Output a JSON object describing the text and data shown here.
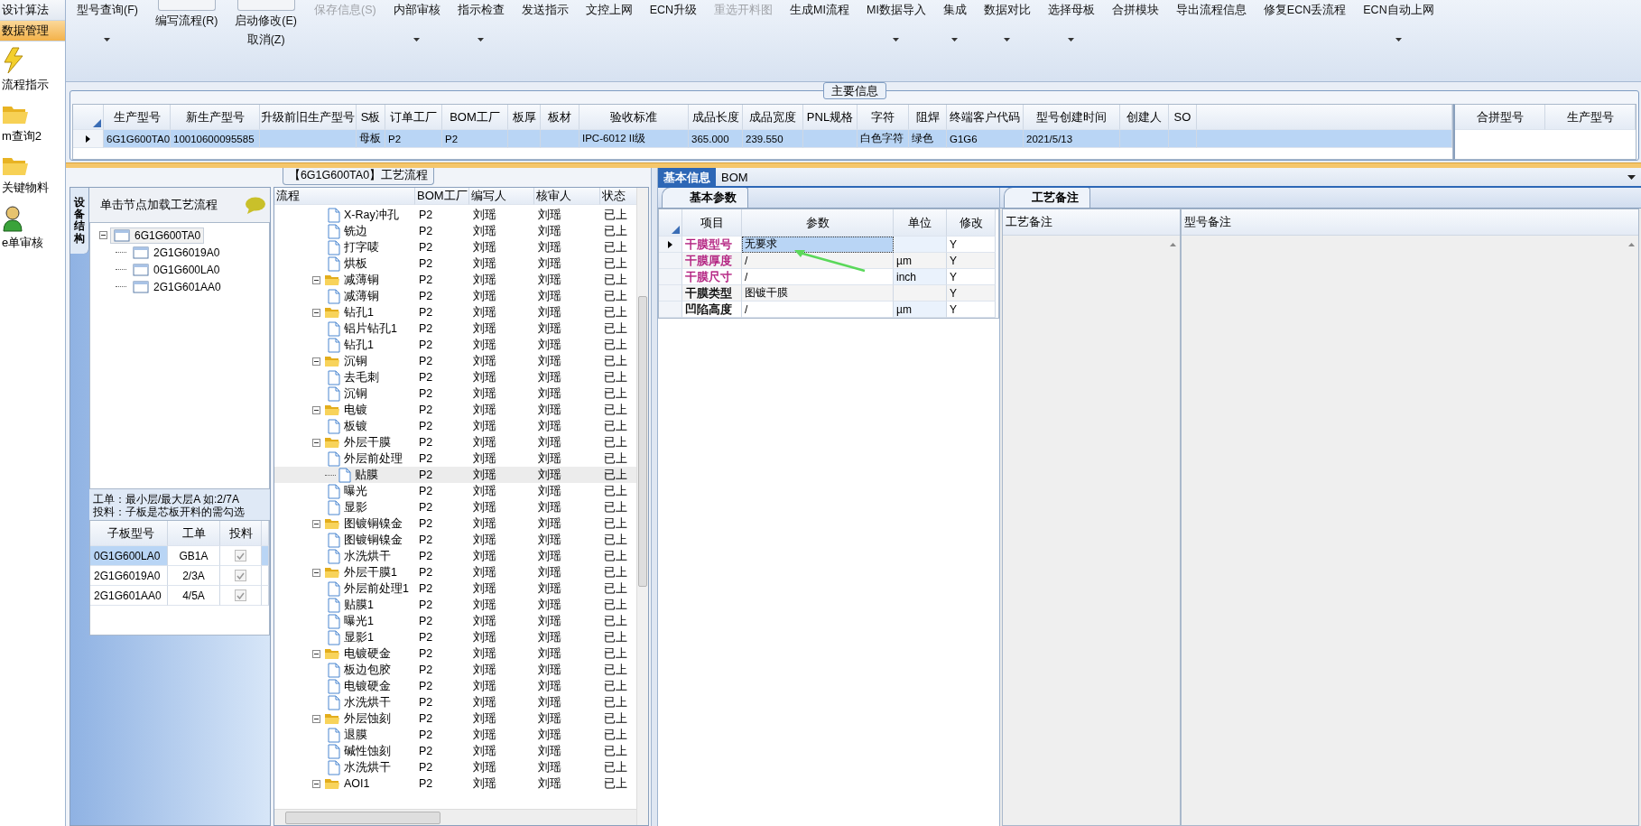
{
  "sidebar": {
    "items": [
      {
        "label": "设计算法",
        "kind": "text",
        "selected": false
      },
      {
        "label": "数据管理",
        "kind": "text",
        "selected": true
      },
      {
        "label": "流程指示",
        "kind": "lightning",
        "selected": false
      },
      {
        "label": "m查询2",
        "kind": "folder",
        "selected": false
      },
      {
        "label": "关键物料",
        "kind": "folder",
        "selected": false
      },
      {
        "label": "e单审核",
        "kind": "person",
        "selected": false
      }
    ]
  },
  "toolbar": {
    "buttons": [
      {
        "label": "型号查询(F)",
        "kind": "plain",
        "dropdown": true,
        "disabled": false
      },
      {
        "label": "编写流程(R)",
        "kind": "toggle",
        "on": false,
        "disabled": false
      },
      {
        "label": "启动修改(E)",
        "kind": "toggle",
        "below": "取消(Z)",
        "on": false,
        "disabled": false
      },
      {
        "label": "保存信息(S)",
        "kind": "plain",
        "dropdown": false,
        "disabled": true
      },
      {
        "label": "内部审核",
        "kind": "plain",
        "dropdown": true,
        "disabled": false
      },
      {
        "label": "指示检查",
        "kind": "plain",
        "dropdown": true,
        "disabled": false
      },
      {
        "label": "发送指示",
        "kind": "plain",
        "dropdown": false,
        "disabled": false
      },
      {
        "label": "文控上网",
        "kind": "plain",
        "dropdown": false,
        "disabled": false
      },
      {
        "label": "ECN升级",
        "kind": "plain",
        "dropdown": false,
        "disabled": false
      },
      {
        "label": "重选开料图",
        "kind": "plain",
        "dropdown": false,
        "disabled": true
      },
      {
        "label": "生成MI流程",
        "kind": "plain",
        "dropdown": false,
        "disabled": false
      },
      {
        "label": "MI数据导入",
        "kind": "plain",
        "dropdown": true,
        "disabled": false
      },
      {
        "label": "集成",
        "kind": "plain",
        "dropdown": true,
        "disabled": false
      },
      {
        "label": "数据对比",
        "kind": "plain",
        "dropdown": true,
        "disabled": false
      },
      {
        "label": "选择母板",
        "kind": "plain",
        "dropdown": true,
        "disabled": false
      },
      {
        "label": "合拼模块",
        "kind": "plain",
        "dropdown": false,
        "disabled": false
      },
      {
        "label": "导出流程信息",
        "kind": "plain",
        "dropdown": false,
        "disabled": false
      },
      {
        "label": "修复ECN丢流程",
        "kind": "plain",
        "dropdown": false,
        "disabled": false
      },
      {
        "label": "ECN自动上网",
        "kind": "plain",
        "dropdown": true,
        "disabled": false
      }
    ]
  },
  "main_info": {
    "title": "主要信息",
    "columns": [
      "生产型号",
      "新生产型号",
      "升级前旧生产型号",
      "S板",
      "订单工厂",
      "BOM工厂",
      "板厚",
      "板材",
      "验收标准",
      "成品长度",
      "成品宽度",
      "PNL规格",
      "字符",
      "阻焊",
      "终端客户代码",
      "型号创建时间",
      "创建人",
      "SO"
    ],
    "rows": [
      {
        "selected": true,
        "cells": [
          "6G1G600TA0",
          "10010600095585",
          "",
          "母板",
          "P2",
          "P2",
          "",
          "",
          "IPC-6012 II级",
          "365.000",
          "239.550",
          "",
          "白色字符",
          "绿色",
          "G1G6",
          "2021/5/13",
          "",
          ""
        ]
      }
    ],
    "side_columns": [
      "合拼型号",
      "生产型号"
    ]
  },
  "flow_panel": {
    "title": "【6G1G600TA0】工艺流程",
    "side_tab": "设备结构",
    "hint": "单击节点加载工艺流程",
    "tree": [
      {
        "label": "6G1G600TA0",
        "selected": true,
        "children": [
          {
            "label": "2G1G6019A0",
            "selected": false
          },
          {
            "label": "0G1G600LA0",
            "selected": false
          },
          {
            "label": "2G1G601AA0",
            "selected": false
          }
        ]
      }
    ],
    "notes": [
      "工单：最小层/最大层A 如:2/7A",
      "投料：子板是芯板开料的需勾选"
    ],
    "sub_table": {
      "columns": [
        "子板型号",
        "工单",
        "投料"
      ],
      "rows": [
        {
          "model": "0G1G600LA0",
          "order": "GB1A",
          "checked": true,
          "selected": true
        },
        {
          "model": "2G1G6019A0",
          "order": "2/3A",
          "checked": true,
          "selected": false
        },
        {
          "model": "2G1G601AA0",
          "order": "4/5A",
          "checked": true,
          "selected": false
        }
      ]
    }
  },
  "process": {
    "columns": [
      "流程",
      "BOM工厂",
      "编写人",
      "核审人",
      "状态"
    ],
    "groups": [
      {
        "children": [
          {
            "name": "X-Ray冲孔",
            "bom": "P2",
            "writer": "刘瑶",
            "reviewer": "刘瑶",
            "status": "已上",
            "selected": false
          },
          {
            "name": "铣边",
            "bom": "P2",
            "writer": "刘瑶",
            "reviewer": "刘瑶",
            "status": "已上",
            "selected": false
          },
          {
            "name": "打字唛",
            "bom": "P2",
            "writer": "刘瑶",
            "reviewer": "刘瑶",
            "status": "已上",
            "selected": false
          },
          {
            "name": "烘板",
            "bom": "P2",
            "writer": "刘瑶",
            "reviewer": "刘瑶",
            "status": "已上",
            "selected": false
          }
        ]
      },
      {
        "name": "减薄铜",
        "bom": "P2",
        "writer": "刘瑶",
        "reviewer": "刘瑶",
        "status": "已上",
        "selected": false,
        "expanded": true,
        "children": [
          {
            "name": "减薄铜",
            "bom": "P2",
            "writer": "刘瑶",
            "reviewer": "刘瑶",
            "status": "已上",
            "selected": false
          }
        ]
      },
      {
        "name": "钻孔1",
        "bom": "P2",
        "writer": "刘瑶",
        "reviewer": "刘瑶",
        "status": "已上",
        "selected": false,
        "expanded": true,
        "children": [
          {
            "name": "铝片钻孔1",
            "bom": "P2",
            "writer": "刘瑶",
            "reviewer": "刘瑶",
            "status": "已上",
            "selected": false
          },
          {
            "name": "钻孔1",
            "bom": "P2",
            "writer": "刘瑶",
            "reviewer": "刘瑶",
            "status": "已上",
            "selected": false
          }
        ]
      },
      {
        "name": "沉铜",
        "bom": "P2",
        "writer": "刘瑶",
        "reviewer": "刘瑶",
        "status": "已上",
        "selected": false,
        "expanded": true,
        "children": [
          {
            "name": "去毛刺",
            "bom": "P2",
            "writer": "刘瑶",
            "reviewer": "刘瑶",
            "status": "已上",
            "selected": false
          },
          {
            "name": "沉铜",
            "bom": "P2",
            "writer": "刘瑶",
            "reviewer": "刘瑶",
            "status": "已上",
            "selected": false
          }
        ]
      },
      {
        "name": "电镀",
        "bom": "P2",
        "writer": "刘瑶",
        "reviewer": "刘瑶",
        "status": "已上",
        "selected": false,
        "expanded": true,
        "children": [
          {
            "name": "板镀",
            "bom": "P2",
            "writer": "刘瑶",
            "reviewer": "刘瑶",
            "status": "已上",
            "selected": false
          }
        ]
      },
      {
        "name": "外层干膜",
        "bom": "P2",
        "writer": "刘瑶",
        "reviewer": "刘瑶",
        "status": "已上",
        "selected": false,
        "expanded": true,
        "children": [
          {
            "name": "外层前处理",
            "bom": "P2",
            "writer": "刘瑶",
            "reviewer": "刘瑶",
            "status": "已上",
            "selected": false
          },
          {
            "name": "贴膜",
            "bom": "P2",
            "writer": "刘瑶",
            "reviewer": "刘瑶",
            "status": "已上",
            "selected": true
          },
          {
            "name": "曝光",
            "bom": "P2",
            "writer": "刘瑶",
            "reviewer": "刘瑶",
            "status": "已上",
            "selected": false
          },
          {
            "name": "显影",
            "bom": "P2",
            "writer": "刘瑶",
            "reviewer": "刘瑶",
            "status": "已上",
            "selected": false
          }
        ]
      },
      {
        "name": "图镀铜镍金",
        "bom": "P2",
        "writer": "刘瑶",
        "reviewer": "刘瑶",
        "status": "已上",
        "selected": false,
        "expanded": true,
        "children": [
          {
            "name": "图镀铜镍金",
            "bom": "P2",
            "writer": "刘瑶",
            "reviewer": "刘瑶",
            "status": "已上",
            "selected": false
          },
          {
            "name": "水洗烘干",
            "bom": "P2",
            "writer": "刘瑶",
            "reviewer": "刘瑶",
            "status": "已上",
            "selected": false
          }
        ]
      },
      {
        "name": "外层干膜1",
        "bom": "P2",
        "writer": "刘瑶",
        "reviewer": "刘瑶",
        "status": "已上",
        "selected": false,
        "expanded": true,
        "children": [
          {
            "name": "外层前处理1",
            "bom": "P2",
            "writer": "刘瑶",
            "reviewer": "刘瑶",
            "status": "已上",
            "selected": false
          },
          {
            "name": "贴膜1",
            "bom": "P2",
            "writer": "刘瑶",
            "reviewer": "刘瑶",
            "status": "已上",
            "selected": false
          },
          {
            "name": "曝光1",
            "bom": "P2",
            "writer": "刘瑶",
            "reviewer": "刘瑶",
            "status": "已上",
            "selected": false
          },
          {
            "name": "显影1",
            "bom": "P2",
            "writer": "刘瑶",
            "reviewer": "刘瑶",
            "status": "已上",
            "selected": false
          }
        ]
      },
      {
        "name": "电镀硬金",
        "bom": "P2",
        "writer": "刘瑶",
        "reviewer": "刘瑶",
        "status": "已上",
        "selected": false,
        "expanded": true,
        "children": [
          {
            "name": "板边包胶",
            "bom": "P2",
            "writer": "刘瑶",
            "reviewer": "刘瑶",
            "status": "已上",
            "selected": false
          },
          {
            "name": "电镀硬金",
            "bom": "P2",
            "writer": "刘瑶",
            "reviewer": "刘瑶",
            "status": "已上",
            "selected": false
          },
          {
            "name": "水洗烘干",
            "bom": "P2",
            "writer": "刘瑶",
            "reviewer": "刘瑶",
            "status": "已上",
            "selected": false
          }
        ]
      },
      {
        "name": "外层蚀刻",
        "bom": "P2",
        "writer": "刘瑶",
        "reviewer": "刘瑶",
        "status": "已上",
        "selected": false,
        "expanded": true,
        "children": [
          {
            "name": "退膜",
            "bom": "P2",
            "writer": "刘瑶",
            "reviewer": "刘瑶",
            "status": "已上",
            "selected": false
          },
          {
            "name": "碱性蚀刻",
            "bom": "P2",
            "writer": "刘瑶",
            "reviewer": "刘瑶",
            "status": "已上",
            "selected": false
          },
          {
            "name": "水洗烘干",
            "bom": "P2",
            "writer": "刘瑶",
            "reviewer": "刘瑶",
            "status": "已上",
            "selected": false
          }
        ]
      },
      {
        "name": "AOI1",
        "bom": "P2",
        "writer": "刘瑶",
        "reviewer": "刘瑶",
        "status": "已上",
        "selected": false,
        "expanded": true
      }
    ]
  },
  "details": {
    "tabs": [
      {
        "label": "基本信息",
        "selected": true
      },
      {
        "label": "BOM",
        "selected": false
      }
    ],
    "sub_tab": "基本参数",
    "columns": [
      "项目",
      "参数",
      "单位",
      "修改"
    ],
    "rows": [
      {
        "item": "干膜型号",
        "param": "无要求",
        "unit": "",
        "edit": "Y",
        "color": "#b0187c",
        "selected": true
      },
      {
        "item": "干膜厚度",
        "param": "/",
        "unit": "µm",
        "edit": "Y",
        "color": "#b0187c",
        "selected": false
      },
      {
        "item": "干膜尺寸",
        "param": "/",
        "unit": "inch",
        "edit": "Y",
        "color": "#b0187c",
        "selected": false
      },
      {
        "item": "干膜类型",
        "param": "图镀干膜",
        "unit": "",
        "edit": "Y",
        "color": "#000000",
        "selected": false
      },
      {
        "item": "凹陷高度",
        "param": "/",
        "unit": "µm",
        "edit": "Y",
        "color": "#000000",
        "selected": false
      }
    ]
  },
  "remarks": {
    "tab": "工艺备注",
    "columns": [
      "工艺备注",
      "型号备注"
    ]
  }
}
